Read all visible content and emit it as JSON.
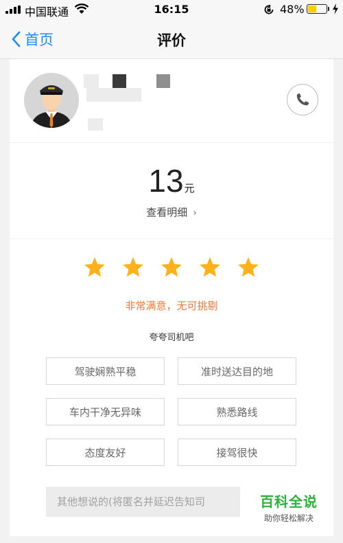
{
  "status_bar": {
    "carrier": "中国联通",
    "time": "16:15",
    "battery_percent": "48%",
    "battery_level": 0.48,
    "icons": [
      "signal-icon",
      "wifi-icon",
      "orientation-lock-icon",
      "battery-icon",
      "charging-icon"
    ]
  },
  "nav": {
    "back_label": "首页",
    "title": "评价"
  },
  "driver": {
    "avatar_icon": "driver-avatar-icon",
    "phone_icon": "phone-icon"
  },
  "fare": {
    "amount": "13",
    "unit": "元",
    "detail_label": "查看明细",
    "detail_chevron": "›"
  },
  "rating": {
    "stars": 5,
    "max_stars": 5,
    "star_color": "#ffb11b",
    "text": "非常满意，无可挑剔",
    "text_color": "#f07a3a"
  },
  "praise": {
    "title": "夸夸司机吧",
    "tags": [
      "驾驶娴熟平稳",
      "准时送达目的地",
      "车内干净无异味",
      "熟悉路线",
      "态度友好",
      "接驾很快"
    ]
  },
  "comment": {
    "placeholder": "其他想说的(将匿名并延迟告知司"
  },
  "watermark": {
    "main": "百科全说",
    "sub": "助你轻松解决"
  }
}
